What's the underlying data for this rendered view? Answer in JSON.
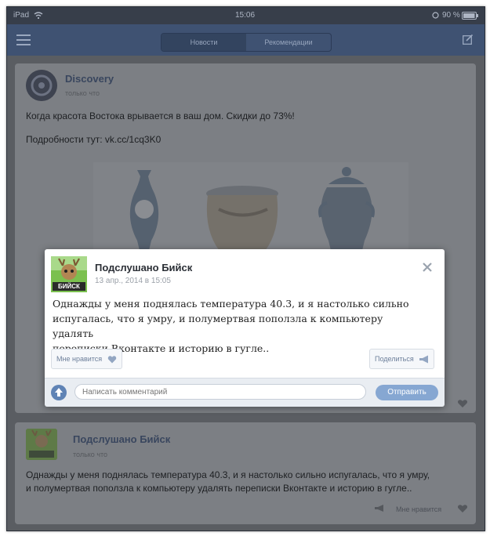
{
  "status_bar": {
    "device": "iPad",
    "time": "15:06",
    "battery": "90 %"
  },
  "navbar": {
    "tabs": [
      {
        "label": "Новости",
        "active": true
      },
      {
        "label": "Рекомендации",
        "active": false
      }
    ]
  },
  "feed": {
    "post1": {
      "author": "Discovery",
      "time": "только что",
      "text_line1": "Когда красота Востока врывается в ваш дом. Скидки до 73%!",
      "text_line2": "Подробности тут: vk.cc/1cq3K0"
    },
    "post2": {
      "author": "Подслушано Бийск",
      "time": "только что",
      "text_line1": "Однажды у меня поднялась температура 40.3, и я настолько сильно испугалась, что я умру,",
      "text_line2": "и полумертвая поползла к компьютеру удалять переписки Вконтакте и историю в гугле..",
      "like_label": "Мне нравится"
    }
  },
  "modal": {
    "author": "Подслушано Бийск",
    "avatar_text": "БИЙСК",
    "date": "13 апр., 2014 в 15:05",
    "text_lines": [
      "Однажды у меня поднялась температура 40.3, и я настолько сильно",
      "испугалась, что я умру, и полумертвая поползла к компьютеру удалять",
      "переписки Вконтакте и историю в гугле.."
    ],
    "like_label": "Мне нравится",
    "share_label": "Поделиться",
    "comment_placeholder": "Написать комментарий",
    "send_label": "Отправить"
  },
  "colors": {
    "accent": "#5f83b5",
    "navbar": "#3f5272",
    "send_button": "#86a7d2"
  }
}
